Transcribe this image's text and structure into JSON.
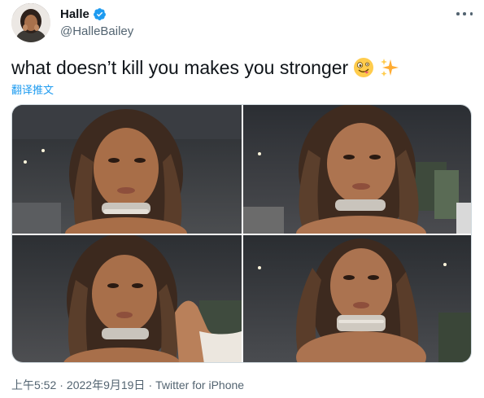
{
  "author": {
    "display_name": "Halle",
    "handle": "@HalleBailey",
    "verified": true,
    "accent_color": "#1d9bf0"
  },
  "tweet": {
    "text": "what doesn’t kill you makes you stronger",
    "emojis": [
      "zany-face-icon",
      "sparkles-icon"
    ],
    "translate_label": "翻译推文"
  },
  "media": {
    "photos": [
      {
        "label": "selfie-1"
      },
      {
        "label": "selfie-2"
      },
      {
        "label": "selfie-3"
      },
      {
        "label": "selfie-4"
      }
    ]
  },
  "meta": {
    "time": "上午5:52",
    "date": "2022年9月19日",
    "separator": "·",
    "source": "Twitter for iPhone"
  },
  "colors": {
    "text": "#0f1419",
    "secondary": "#536471",
    "link": "#1d9bf0",
    "border": "#cfd9de"
  }
}
